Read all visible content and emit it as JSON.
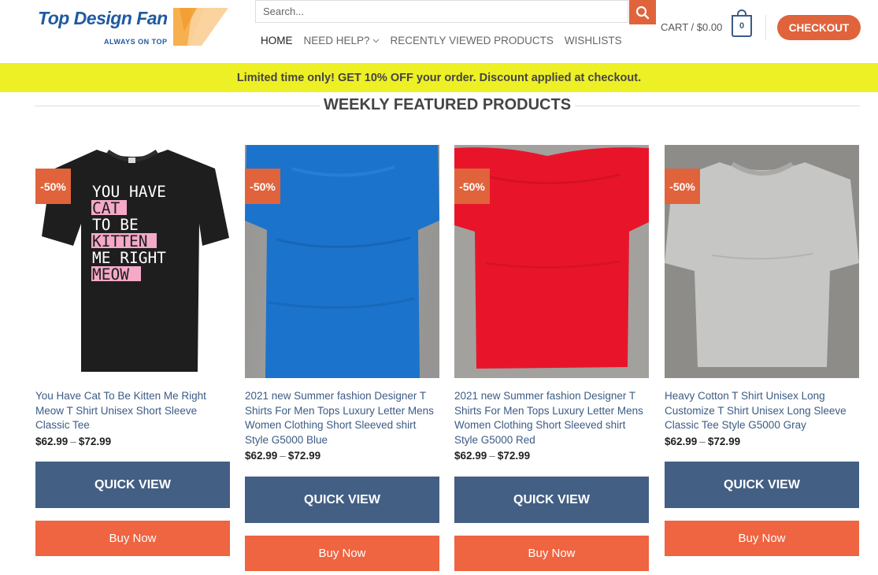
{
  "brand": {
    "name": "Top Design Fan",
    "tagline": "ALWAYS ON TOP",
    "primary_color": "#1f5aa0",
    "accent_color": "#e0633c"
  },
  "search": {
    "placeholder": "Search...",
    "icon": "search-icon"
  },
  "nav": {
    "items": [
      {
        "label": "HOME",
        "active": true
      },
      {
        "label": "NEED HELP?",
        "has_dropdown": true
      },
      {
        "label": "RECENTLY VIEWED PRODUCTS"
      },
      {
        "label": "WISHLISTS"
      }
    ]
  },
  "cart": {
    "label": "CART /",
    "total": "$0.00",
    "count": "0"
  },
  "checkout_label": "CHECKOUT",
  "promo": {
    "text": "Limited time only! GET 10% OFF your order. Discount applied at checkout.",
    "background": "#eef026"
  },
  "section": {
    "title": "WEEKLY FEATURED PRODUCTS"
  },
  "products": [
    {
      "badge": "-50%",
      "title": "You Have Cat To Be Kitten Me Right Meow T Shirt Unisex Short Sleeve Classic Tee",
      "price_min": "$62.99",
      "price_sep": "–",
      "price_max": "$72.99",
      "shirt_color": "black",
      "print_lines": [
        "YOU HAVE",
        "CAT",
        "TO BE",
        "KITTEN",
        "ME RIGHT",
        "MEOW"
      ],
      "quick_view": "QUICK VIEW",
      "buy": "Buy Now"
    },
    {
      "badge": "-50%",
      "title": "2021 new Summer fashion Designer T Shirts For Men Tops Luxury Letter Mens Women Clothing Short Sleeved shirt Style G5000 Blue",
      "price_min": "$62.99",
      "price_sep": "–",
      "price_max": "$72.99",
      "shirt_color": "blue",
      "quick_view": "QUICK VIEW",
      "buy": "Buy Now"
    },
    {
      "badge": "-50%",
      "title": "2021 new Summer fashion Designer T Shirts For Men Tops Luxury Letter Mens Women Clothing Short Sleeved shirt Style G5000 Red",
      "price_min": "$62.99",
      "price_sep": "–",
      "price_max": "$72.99",
      "shirt_color": "red",
      "quick_view": "QUICK VIEW",
      "buy": "Buy Now"
    },
    {
      "badge": "-50%",
      "title": "Heavy Cotton T Shirt Unisex Long Customize T Shirt Unisex Long Sleeve Classic Tee Style G5000 Gray",
      "price_min": "$62.99",
      "price_sep": "–",
      "price_max": "$72.99",
      "shirt_color": "gray",
      "quick_view": "QUICK VIEW",
      "buy": "Buy Now"
    }
  ]
}
